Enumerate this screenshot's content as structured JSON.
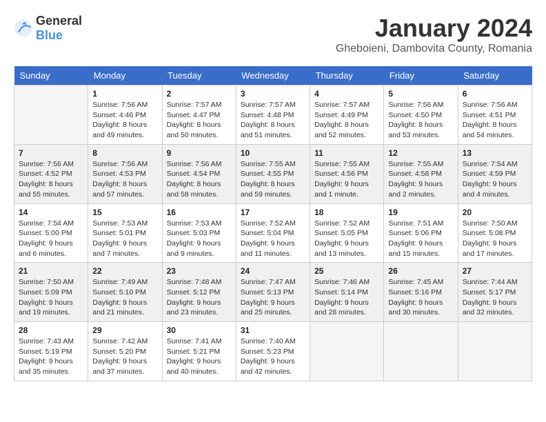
{
  "header": {
    "logo_general": "General",
    "logo_blue": "Blue",
    "month_title": "January 2024",
    "location": "Gheboieni, Dambovita County, Romania"
  },
  "weekdays": [
    "Sunday",
    "Monday",
    "Tuesday",
    "Wednesday",
    "Thursday",
    "Friday",
    "Saturday"
  ],
  "weeks": [
    [
      {
        "day": "",
        "detail": ""
      },
      {
        "day": "1",
        "detail": "Sunrise: 7:56 AM\nSunset: 4:46 PM\nDaylight: 8 hours\nand 49 minutes."
      },
      {
        "day": "2",
        "detail": "Sunrise: 7:57 AM\nSunset: 4:47 PM\nDaylight: 8 hours\nand 50 minutes."
      },
      {
        "day": "3",
        "detail": "Sunrise: 7:57 AM\nSunset: 4:48 PM\nDaylight: 8 hours\nand 51 minutes."
      },
      {
        "day": "4",
        "detail": "Sunrise: 7:57 AM\nSunset: 4:49 PM\nDaylight: 8 hours\nand 52 minutes."
      },
      {
        "day": "5",
        "detail": "Sunrise: 7:56 AM\nSunset: 4:50 PM\nDaylight: 8 hours\nand 53 minutes."
      },
      {
        "day": "6",
        "detail": "Sunrise: 7:56 AM\nSunset: 4:51 PM\nDaylight: 8 hours\nand 54 minutes."
      }
    ],
    [
      {
        "day": "7",
        "detail": "Sunrise: 7:56 AM\nSunset: 4:52 PM\nDaylight: 8 hours\nand 55 minutes."
      },
      {
        "day": "8",
        "detail": "Sunrise: 7:56 AM\nSunset: 4:53 PM\nDaylight: 8 hours\nand 57 minutes."
      },
      {
        "day": "9",
        "detail": "Sunrise: 7:56 AM\nSunset: 4:54 PM\nDaylight: 8 hours\nand 58 minutes."
      },
      {
        "day": "10",
        "detail": "Sunrise: 7:55 AM\nSunset: 4:55 PM\nDaylight: 8 hours\nand 59 minutes."
      },
      {
        "day": "11",
        "detail": "Sunrise: 7:55 AM\nSunset: 4:56 PM\nDaylight: 9 hours\nand 1 minute."
      },
      {
        "day": "12",
        "detail": "Sunrise: 7:55 AM\nSunset: 4:58 PM\nDaylight: 9 hours\nand 2 minutes."
      },
      {
        "day": "13",
        "detail": "Sunrise: 7:54 AM\nSunset: 4:59 PM\nDaylight: 9 hours\nand 4 minutes."
      }
    ],
    [
      {
        "day": "14",
        "detail": "Sunrise: 7:54 AM\nSunset: 5:00 PM\nDaylight: 9 hours\nand 6 minutes."
      },
      {
        "day": "15",
        "detail": "Sunrise: 7:53 AM\nSunset: 5:01 PM\nDaylight: 9 hours\nand 7 minutes."
      },
      {
        "day": "16",
        "detail": "Sunrise: 7:53 AM\nSunset: 5:03 PM\nDaylight: 9 hours\nand 9 minutes."
      },
      {
        "day": "17",
        "detail": "Sunrise: 7:52 AM\nSunset: 5:04 PM\nDaylight: 9 hours\nand 11 minutes."
      },
      {
        "day": "18",
        "detail": "Sunrise: 7:52 AM\nSunset: 5:05 PM\nDaylight: 9 hours\nand 13 minutes."
      },
      {
        "day": "19",
        "detail": "Sunrise: 7:51 AM\nSunset: 5:06 PM\nDaylight: 9 hours\nand 15 minutes."
      },
      {
        "day": "20",
        "detail": "Sunrise: 7:50 AM\nSunset: 5:08 PM\nDaylight: 9 hours\nand 17 minutes."
      }
    ],
    [
      {
        "day": "21",
        "detail": "Sunrise: 7:50 AM\nSunset: 5:09 PM\nDaylight: 9 hours\nand 19 minutes."
      },
      {
        "day": "22",
        "detail": "Sunrise: 7:49 AM\nSunset: 5:10 PM\nDaylight: 9 hours\nand 21 minutes."
      },
      {
        "day": "23",
        "detail": "Sunrise: 7:48 AM\nSunset: 5:12 PM\nDaylight: 9 hours\nand 23 minutes."
      },
      {
        "day": "24",
        "detail": "Sunrise: 7:47 AM\nSunset: 5:13 PM\nDaylight: 9 hours\nand 25 minutes."
      },
      {
        "day": "25",
        "detail": "Sunrise: 7:46 AM\nSunset: 5:14 PM\nDaylight: 9 hours\nand 28 minutes."
      },
      {
        "day": "26",
        "detail": "Sunrise: 7:45 AM\nSunset: 5:16 PM\nDaylight: 9 hours\nand 30 minutes."
      },
      {
        "day": "27",
        "detail": "Sunrise: 7:44 AM\nSunset: 5:17 PM\nDaylight: 9 hours\nand 32 minutes."
      }
    ],
    [
      {
        "day": "28",
        "detail": "Sunrise: 7:43 AM\nSunset: 5:19 PM\nDaylight: 9 hours\nand 35 minutes."
      },
      {
        "day": "29",
        "detail": "Sunrise: 7:42 AM\nSunset: 5:20 PM\nDaylight: 9 hours\nand 37 minutes."
      },
      {
        "day": "30",
        "detail": "Sunrise: 7:41 AM\nSunset: 5:21 PM\nDaylight: 9 hours\nand 40 minutes."
      },
      {
        "day": "31",
        "detail": "Sunrise: 7:40 AM\nSunset: 5:23 PM\nDaylight: 9 hours\nand 42 minutes."
      },
      {
        "day": "",
        "detail": ""
      },
      {
        "day": "",
        "detail": ""
      },
      {
        "day": "",
        "detail": ""
      }
    ]
  ]
}
